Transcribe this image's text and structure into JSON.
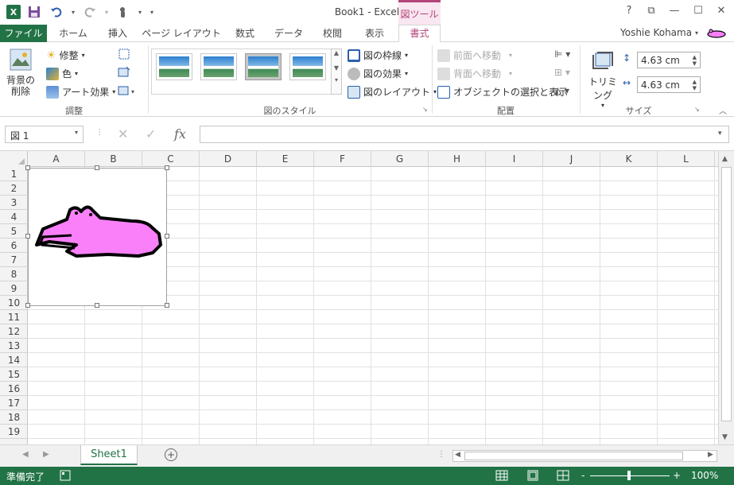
{
  "window": {
    "title": "Book1 - Excel",
    "tool_context": "図ツール",
    "help": "?",
    "restore_ribbon": "⧉",
    "minimize": "—",
    "maximize": "☐",
    "close": "✕"
  },
  "tabs": {
    "file": "ファイル",
    "items": [
      "ホーム",
      "挿入",
      "ページ レイアウト",
      "数式",
      "データ",
      "校閲",
      "表示"
    ],
    "active": "書式"
  },
  "user": {
    "name": "Yoshie Kohama"
  },
  "ribbon": {
    "adjust": {
      "remove_bg_line1": "背景の",
      "remove_bg_line2": "削除",
      "corrections": "修整",
      "color": "色",
      "artistic": "アート効果",
      "label": "調整"
    },
    "styles": {
      "border": "図の枠線",
      "effects": "図の効果",
      "layout": "図のレイアウト",
      "label": "図のスタイル"
    },
    "arrange": {
      "bring_forward": "前面へ移動",
      "send_backward": "背面へ移動",
      "selection_pane": "オブジェクトの選択と表示",
      "label": "配置"
    },
    "size": {
      "crop": "トリミング",
      "height": "4.63 cm",
      "width": "4.63 cm",
      "label": "サイズ"
    }
  },
  "formula_bar": {
    "name_box": "図 1",
    "cancel": "✕",
    "enter": "✓",
    "fx": "fx",
    "value": ""
  },
  "grid": {
    "columns": [
      "A",
      "B",
      "C",
      "D",
      "E",
      "F",
      "G",
      "H",
      "I",
      "J",
      "K",
      "L"
    ],
    "rows": [
      "1",
      "2",
      "3",
      "4",
      "5",
      "6",
      "7",
      "8",
      "9",
      "10",
      "11",
      "12",
      "13",
      "14",
      "15",
      "16",
      "17",
      "18",
      "19"
    ]
  },
  "sheets": {
    "active": "Sheet1"
  },
  "status": {
    "ready": "準備完了",
    "zoom_minus": "-",
    "zoom_plus": "+",
    "zoom": "100%"
  },
  "colors": {
    "excel_green": "#217346",
    "tool_pink": "#b4457b",
    "drawing_fill": "#fa80fa",
    "drawing_stroke": "#000000"
  }
}
